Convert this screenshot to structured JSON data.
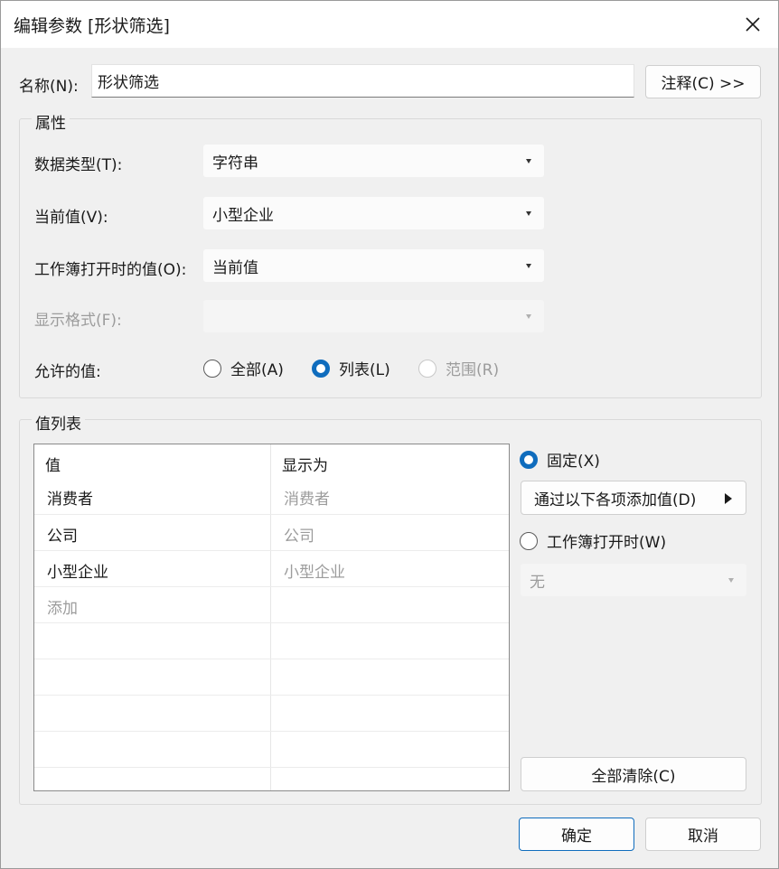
{
  "window": {
    "title": "编辑参数 [形状筛选]"
  },
  "name": {
    "label": "名称(N):",
    "value": "形状筛选",
    "comment_button": "注释(C) >>"
  },
  "properties": {
    "group_title": "属性",
    "data_type": {
      "label": "数据类型(T):",
      "value": "字符串"
    },
    "current_value": {
      "label": "当前值(V):",
      "value": "小型企业"
    },
    "workbook_open_value": {
      "label": "工作簿打开时的值(O):",
      "value": "当前值"
    },
    "display_format": {
      "label": "显示格式(F):",
      "value": ""
    },
    "allowed_values": {
      "label": "允许的值:",
      "options": [
        {
          "label": "全部(A)",
          "checked": false,
          "disabled": false
        },
        {
          "label": "列表(L)",
          "checked": true,
          "disabled": false
        },
        {
          "label": "范围(R)",
          "checked": false,
          "disabled": true
        }
      ]
    }
  },
  "value_list": {
    "group_title": "值列表",
    "columns": [
      "值",
      "显示为"
    ],
    "rows": [
      {
        "value": "消费者",
        "display": "消费者"
      },
      {
        "value": "公司",
        "display": "公司"
      },
      {
        "value": "小型企业",
        "display": "小型企业"
      }
    ],
    "add_placeholder": "添加",
    "fixed_radio": "固定(X)",
    "add_from_button": "通过以下各项添加值(D)",
    "on_open_radio": "工作簿打开时(W)",
    "on_open_value": "无",
    "clear_all_button": "全部清除(C)"
  },
  "footer": {
    "ok_button": "确定",
    "cancel_button": "取消"
  },
  "colors": {
    "accent": "#0f6cbd",
    "muted_text": "#9c9c9c"
  }
}
